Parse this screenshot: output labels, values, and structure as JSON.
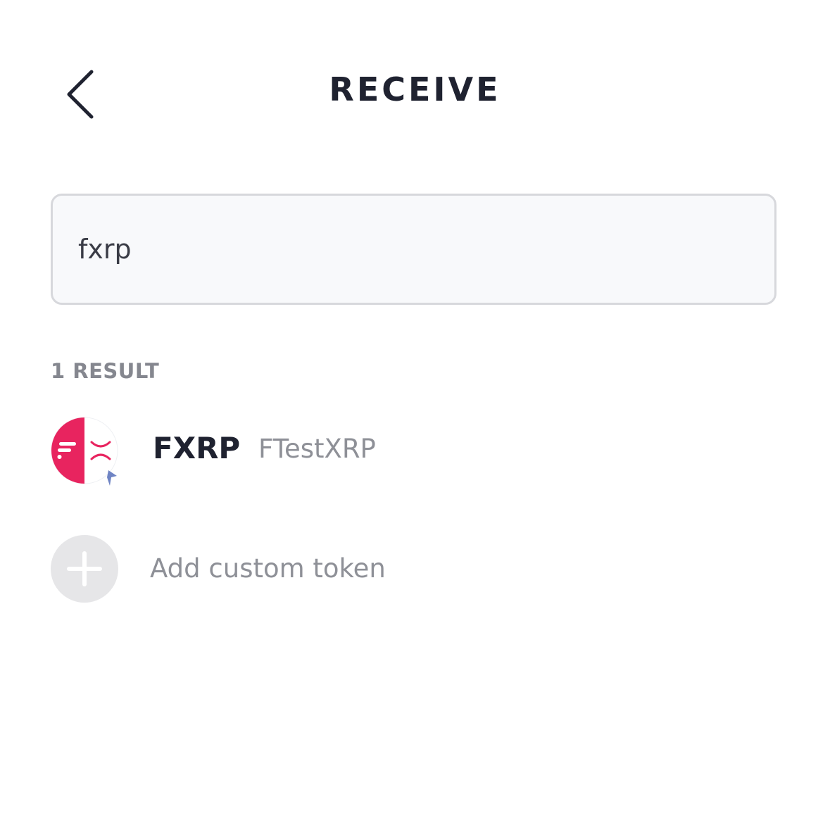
{
  "header": {
    "title": "RECEIVE",
    "back_icon": "chevron-left-icon"
  },
  "search": {
    "value": "fxrp",
    "placeholder": ""
  },
  "results": {
    "count_label": "1 RESULT",
    "items": [
      {
        "symbol": "FXRP",
        "name": "FTestXRP",
        "logo_icon": "fxrp-token-logo-icon",
        "logo_colors": {
          "primary": "#e8245f",
          "secondary": "#ffffff",
          "badge": "#6f84c4"
        }
      }
    ]
  },
  "add_token": {
    "label": "Add custom token",
    "icon": "plus-icon"
  }
}
